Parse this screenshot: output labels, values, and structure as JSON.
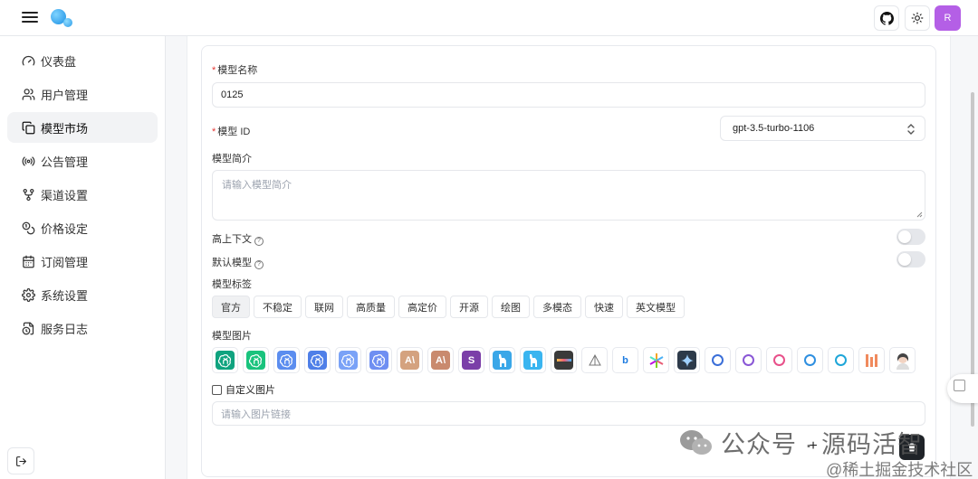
{
  "header": {
    "menu_icon": "hamburger-icon",
    "github_icon": "github-icon",
    "theme_icon": "sun-icon",
    "avatar_letter": "R",
    "avatar_color": "#b45fe6"
  },
  "sidebar": {
    "items": [
      {
        "label": "仪表盘",
        "icon": "gauge-icon"
      },
      {
        "label": "用户管理",
        "icon": "users-icon"
      },
      {
        "label": "模型市场",
        "icon": "copy-icon"
      },
      {
        "label": "公告管理",
        "icon": "broadcast-icon"
      },
      {
        "label": "渠道设置",
        "icon": "git-branch-icon"
      },
      {
        "label": "价格设定",
        "icon": "coins-icon"
      },
      {
        "label": "订阅管理",
        "icon": "calendar-icon"
      },
      {
        "label": "系统设置",
        "icon": "settings-icon"
      },
      {
        "label": "服务日志",
        "icon": "file-clock-icon"
      }
    ],
    "active_index": 2,
    "logout_icon": "logout-icon"
  },
  "form": {
    "name_label": "模型名称",
    "name_value": "0125",
    "id_label": "模型 ID",
    "id_value": "gpt-3.5-turbo-1106",
    "desc_label": "模型简介",
    "desc_placeholder": "请输入模型简介",
    "context_label": "高上下文",
    "default_label": "默认模型",
    "context_enabled": false,
    "default_enabled": false,
    "tags_label": "模型标签",
    "tags": [
      "官方",
      "不稳定",
      "联网",
      "高质量",
      "高定价",
      "开源",
      "绘图",
      "多模态",
      "快速",
      "英文模型"
    ],
    "active_tag_index": 0,
    "images_label": "模型图片",
    "custom_image_label": "自定义图片",
    "custom_image_placeholder": "请输入图片链接",
    "add_icon": "plus-icon",
    "delete_icon": "trash-icon"
  },
  "model_images": [
    {
      "name": "openai-green-icon",
      "text": "",
      "color": "#10a37f"
    },
    {
      "name": "openai-teal-icon",
      "text": "",
      "color": "#19c37d"
    },
    {
      "name": "openai-blue-icon",
      "text": "",
      "color": "#5b8def"
    },
    {
      "name": "openai-blue-2-icon",
      "text": "",
      "color": "#4f7fe8"
    },
    {
      "name": "openai-light-blue-icon",
      "text": "",
      "color": "#7aa2f7"
    },
    {
      "name": "openai-periwinkle-icon",
      "text": "",
      "color": "#6f8ff2"
    },
    {
      "name": "anthropic-icon",
      "text": "A\\",
      "color": "#d4a27f"
    },
    {
      "name": "anthropic-dark-icon",
      "text": "A\\",
      "color": "#c98a6e"
    },
    {
      "name": "purple-s-icon",
      "text": "S",
      "color": "#7b3fa8"
    },
    {
      "name": "llama-blue-icon",
      "text": "",
      "color": "#3aa7e8"
    },
    {
      "name": "llama-light-blue-icon",
      "text": "",
      "color": "#3ab5f0"
    },
    {
      "name": "dark-bar-icon",
      "text": "",
      "color": "#3a3a3a"
    },
    {
      "name": "sail-icon",
      "text": "",
      "color": "#ffffff"
    },
    {
      "name": "bing-icon",
      "text": "b",
      "color": "#ffffff"
    },
    {
      "name": "pinwheel-icon",
      "text": "",
      "color": "#ffffff"
    },
    {
      "name": "gemini-dark-icon",
      "text": "",
      "color": "#2d3a4a"
    },
    {
      "name": "blue-swirl-icon",
      "text": "",
      "color": "#ffffff"
    },
    {
      "name": "purple-knot-icon",
      "text": "",
      "color": "#ffffff"
    },
    {
      "name": "blue-dot-icon",
      "text": "",
      "color": "#ffffff"
    },
    {
      "name": "blue-moon-icon",
      "text": "",
      "color": "#ffffff"
    },
    {
      "name": "blue-ring-icon",
      "text": "",
      "color": "#ffffff"
    },
    {
      "name": "orange-bars-icon",
      "text": "",
      "color": "#ffffff"
    },
    {
      "name": "portrait-icon",
      "text": "",
      "color": "#ffffff"
    }
  ],
  "watermark": {
    "line1": "公众号 · 源码活智",
    "line2": "@稀土掘金技术社区"
  }
}
